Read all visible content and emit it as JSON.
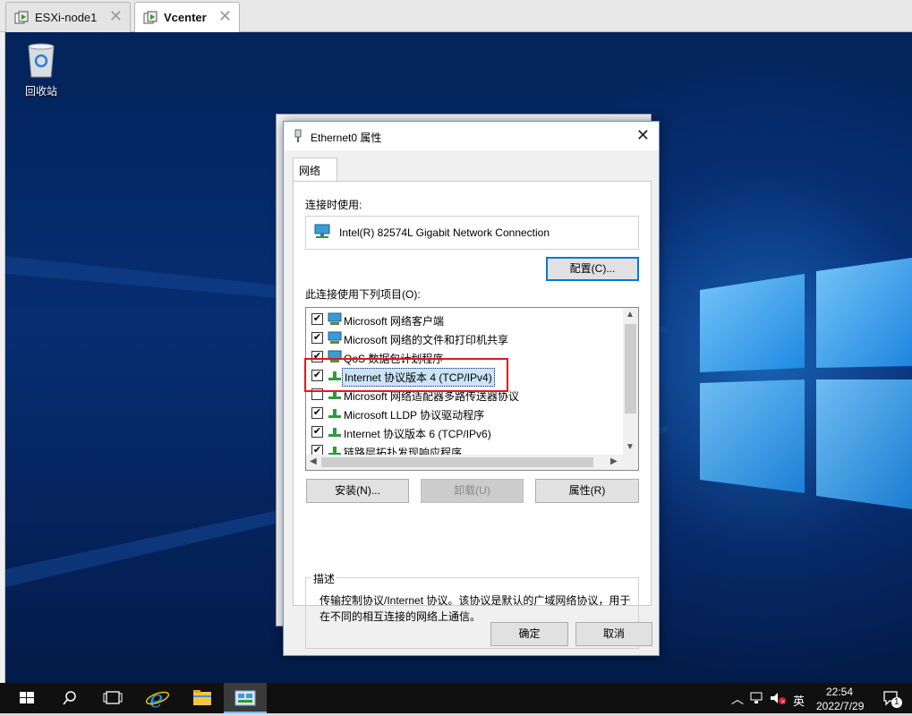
{
  "vm_tabs": [
    {
      "label": "ESXi-node1",
      "close": "✕"
    },
    {
      "label": "Vcenter",
      "close": "✕"
    }
  ],
  "desktop": {
    "recycle_bin_label": "回收站"
  },
  "dialog": {
    "title": "Ethernet0 属性",
    "close": "✕",
    "tab_label": "网络",
    "connect_using_label": "连接时使用:",
    "adapter_name": "Intel(R) 82574L Gigabit Network Connection",
    "configure_button": "配置(C)...",
    "items_label": "此连接使用下列项目(O):",
    "items": [
      {
        "label": "Microsoft 网络客户端",
        "checked": true,
        "icon": "network-client-icon"
      },
      {
        "label": "Microsoft 网络的文件和打印机共享",
        "checked": true,
        "icon": "file-share-icon"
      },
      {
        "label": "QoS 数据包计划程序",
        "checked": true,
        "icon": "qos-icon"
      },
      {
        "label": "Internet 协议版本 4 (TCP/IPv4)",
        "checked": true,
        "icon": "protocol-icon",
        "selected": true
      },
      {
        "label": "Microsoft 网络适配器多路传送器协议",
        "checked": false,
        "icon": "protocol-icon"
      },
      {
        "label": "Microsoft LLDP 协议驱动程序",
        "checked": true,
        "icon": "protocol-icon"
      },
      {
        "label": "Internet 协议版本 6 (TCP/IPv6)",
        "checked": true,
        "icon": "protocol-icon"
      },
      {
        "label": "链路层拓扑发现响应程序",
        "checked": true,
        "icon": "protocol-icon"
      }
    ],
    "install_button": "安装(N)...",
    "uninstall_button": "卸载(U)",
    "properties_button": "属性(R)",
    "description_title": "描述",
    "description_text": "传输控制协议/Internet 协议。该协议是默认的广域网络协议，用于在不同的相互连接的网络上通信。",
    "ok_button": "确定",
    "cancel_button": "取消"
  },
  "taskbar": {
    "tray_ime": "英",
    "time": "22:54",
    "date": "2022/7/29",
    "notification_count": "1"
  },
  "colors": {
    "accent": "#0078d7",
    "highlight_box": "#e0191e",
    "selection": "#cce4f7"
  }
}
